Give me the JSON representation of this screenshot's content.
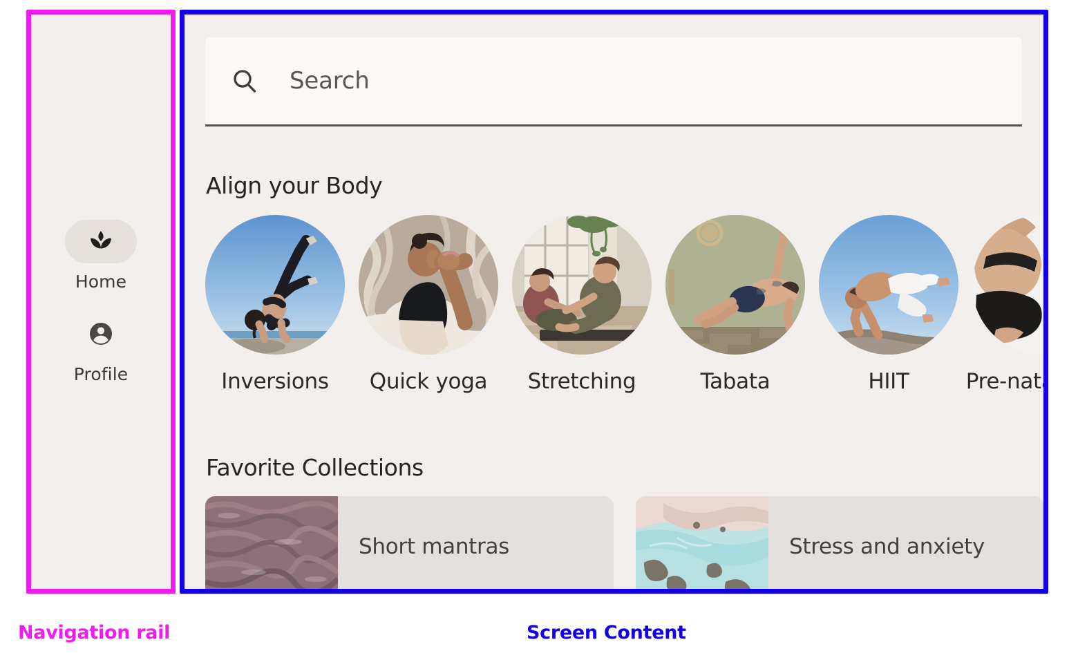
{
  "colors": {
    "surface": "#f2efec",
    "nav_indicator": "#e6e0da",
    "card_surface": "#e3e0dd",
    "search_surface": "#fcfaf9",
    "annot_nav": "#ee1ced",
    "annot_content": "#1200e8",
    "text_primary": "#262321",
    "text_secondary": "#595551"
  },
  "annotations": {
    "nav_rail_label": "Navigation rail",
    "screen_content_label": "Screen Content"
  },
  "nav_rail": {
    "items": [
      {
        "label": "Home",
        "icon": "spa-icon",
        "selected": true
      },
      {
        "label": "Profile",
        "icon": "account-circle-icon",
        "selected": false
      }
    ]
  },
  "search": {
    "icon": "search-icon",
    "placeholder": "Search",
    "value": ""
  },
  "align_section": {
    "title": "Align your Body",
    "items": [
      {
        "label": "Inversions",
        "image": "woman-handstand-beach"
      },
      {
        "label": "Quick yoga",
        "image": "woman-seated-twist-outdoors"
      },
      {
        "label": "Stretching",
        "image": "two-women-studio-stretch"
      },
      {
        "label": "Tabata",
        "image": "man-side-plank-green-wall"
      },
      {
        "label": "HIIT",
        "image": "man-handstand-rock-sky"
      },
      {
        "label": "Pre-natal yoga",
        "label_truncated": "Pre-nat",
        "image": "pregnant-woman-exercise"
      }
    ]
  },
  "favorite_section": {
    "title": "Favorite Collections",
    "cards": [
      {
        "label": "Short mantras",
        "image": "rippled-mauve-water"
      },
      {
        "label": "Stress and anxiety",
        "image": "turquoise-marbled-stone"
      }
    ]
  }
}
